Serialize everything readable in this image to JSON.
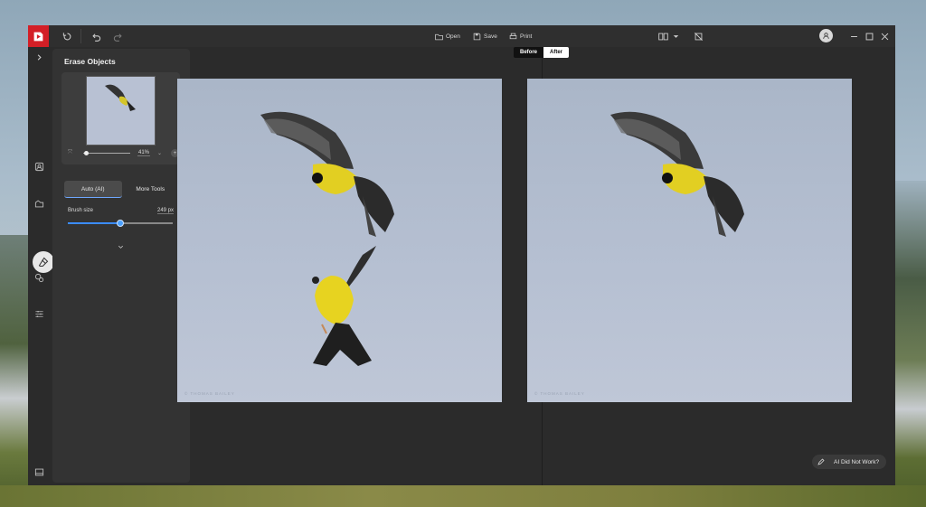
{
  "colors": {
    "brand": "#d31f26",
    "accent": "#3b8cff",
    "app_bg": "#2b2b2b",
    "panel_bg": "#333333"
  },
  "toolbar": {
    "open_label": "Open",
    "save_label": "Save",
    "print_label": "Print",
    "icons": [
      "reset-icon",
      "undo-icon",
      "redo-icon",
      "compare-view-icon",
      "crop-icon",
      "account-icon",
      "minimize-icon",
      "maximize-icon",
      "close-icon"
    ]
  },
  "sidebar": {
    "items": [
      "expand-icon",
      "portrait-icon",
      "background-icon",
      "eraser-icon",
      "replace-face-icon",
      "adjust-icon",
      "preview-icon"
    ],
    "active": "eraser-icon"
  },
  "panel": {
    "title": "Erase Objects",
    "zoom_value": "41%",
    "tabs": [
      "Auto (AI)",
      "More Tools"
    ],
    "active_tab": "Auto (AI)",
    "brush_label": "Brush size",
    "brush_value": "249 px",
    "brush_level": 0.5
  },
  "compare": {
    "before_label": "Before",
    "after_label": "After"
  },
  "watermark": "© THOMAS BAILEY",
  "ai_button_label": "AI Did Not Work?"
}
